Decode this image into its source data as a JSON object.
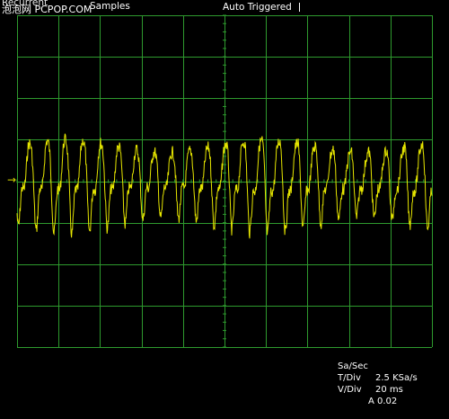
{
  "header": {
    "mode_label": "Recurrent",
    "samples_label": "Samples",
    "trigger_status": "Auto Triggered",
    "watermark": "泡泡网 PCPOP.COM"
  },
  "readout": {
    "sample_rate_label": "Sa/Sec",
    "sample_rate_value": "2.5 KSa/s",
    "time_div_label": "T/Div",
    "time_div_value": "20 ms",
    "volt_div_label": "V/Div",
    "volt_div_value": "A 0.02"
  },
  "colors": {
    "background": "#000000",
    "grid": "#2e9a2e",
    "trace": "#e6e600",
    "text": "#ffffff"
  },
  "icons": {
    "ground_marker": "arrow-right-icon"
  },
  "chart_data": {
    "type": "line",
    "title": "",
    "xlabel": "",
    "ylabel": "",
    "x_divisions": 10,
    "y_divisions": 8,
    "x_range_ms": [
      0,
      200
    ],
    "y_range_div": [
      -4,
      4
    ],
    "series": [
      {
        "description_free": true,
        "x_ms": [],
        "y_div": []
      }
    ]
  }
}
